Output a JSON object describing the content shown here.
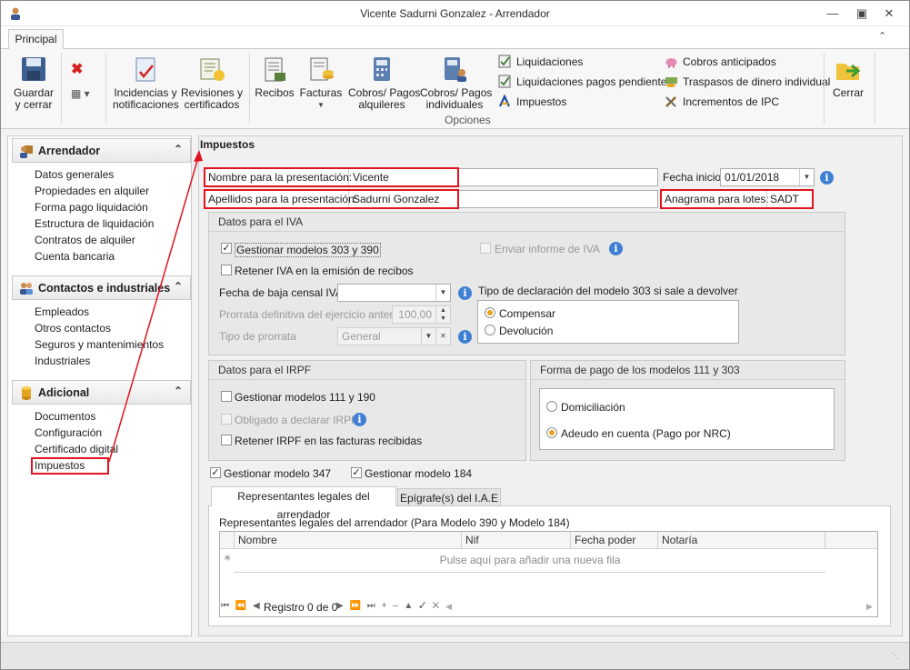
{
  "window": {
    "title": "Vicente Sadurni Gonzalez - Arrendador"
  },
  "ribbon": {
    "tab": "Principal",
    "buttons": {
      "guardar": "Guardar\ny cerrar",
      "incidencias": "Incidencias y\nnotificaciones",
      "revisiones": "Revisiones y\ncertificados",
      "recibos": "Recibos",
      "facturas": "Facturas",
      "cobros_alquileres": "Cobros/ Pagos\nalquileres",
      "cobros_individuales": "Cobros/ Pagos\nindividuales",
      "cerrar": "Cerrar"
    },
    "small_items": {
      "liquidaciones": "Liquidaciones",
      "liquidaciones_pendientes": "Liquidaciones pagos pendientes",
      "impuestos": "Impuestos",
      "cobros_anticipados": "Cobros anticipados",
      "traspasos": "Traspasos de dinero individual",
      "incrementos_ipc": "Incrementos de IPC"
    },
    "group_label": "Opciones"
  },
  "sidebar": {
    "groups": [
      {
        "title": "Arrendador",
        "items": [
          "Datos generales",
          "Propiedades en alquiler",
          "Forma pago liquidación",
          "Estructura de liquidación",
          "Contratos de alquiler",
          "Cuenta bancaria"
        ]
      },
      {
        "title": "Contactos e industriales",
        "items": [
          "Empleados",
          "Otros contactos",
          "Seguros y mantenimientos",
          "Industriales"
        ]
      },
      {
        "title": "Adicional",
        "items": [
          "Documentos",
          "Configuración",
          "Certificado digital",
          "Impuestos"
        ]
      }
    ]
  },
  "main": {
    "title": "Impuestos",
    "nombre_label": "Nombre para la presentación:",
    "nombre_value": "Vicente",
    "apellidos_label": "Apellidos para la presentación:",
    "apellidos_value": "Sadurni Gonzalez",
    "fecha_inicio_label": "Fecha inicio:",
    "fecha_inicio_value": "01/01/2018",
    "anagrama_label": "Anagrama para lotes:",
    "anagrama_value": "SADT",
    "iva": {
      "title": "Datos para el IVA",
      "gestionar": "Gestionar modelos 303 y 390",
      "enviar_informe": "Enviar informe de IVA",
      "retener": "Retener IVA en la emisión de recibos",
      "fecha_baja_label": "Fecha de baja censal IVA",
      "prorrata_def_label": "Prorrata definitiva del ejercicio anterior",
      "prorrata_def_value": "100,00",
      "tipo_prorrata_label": "Tipo de prorrata",
      "tipo_prorrata_value": "General",
      "tipo_decl_label": "Tipo de declaración del modelo 303 si sale a devolver",
      "compensar": "Compensar",
      "devolucion": "Devolución"
    },
    "irpf": {
      "title": "Datos para el IRPF",
      "gestionar": "Gestionar modelos 111 y 190",
      "obligado": "Obligado a declarar IRPF",
      "retener": "Retener IRPF en las facturas recibidas"
    },
    "forma_pago": {
      "title": "Forma de pago de los modelos 111 y 303",
      "domiciliacion": "Domiciliación",
      "adeudo": "Adeudo en cuenta (Pago por NRC)"
    },
    "gestionar_347": "Gestionar modelo 347",
    "gestionar_184": "Gestionar modelo 184",
    "tabs": [
      "Representantes legales del arrendador",
      "Epígrafe(s) del I.A.E"
    ],
    "grid": {
      "caption": "Representantes legales del arrendador (Para Modelo 390 y Modelo 184)",
      "columns": [
        "Nombre",
        "Nif",
        "Fecha poder",
        "Notaría"
      ],
      "new_row": "Pulse aquí para añadir una nueva fila",
      "record": "Registro 0 de 0"
    }
  },
  "colors": {
    "highlight": "#e0141e",
    "accent": "#3f7fd3",
    "radio_on": "#e8a21c"
  }
}
